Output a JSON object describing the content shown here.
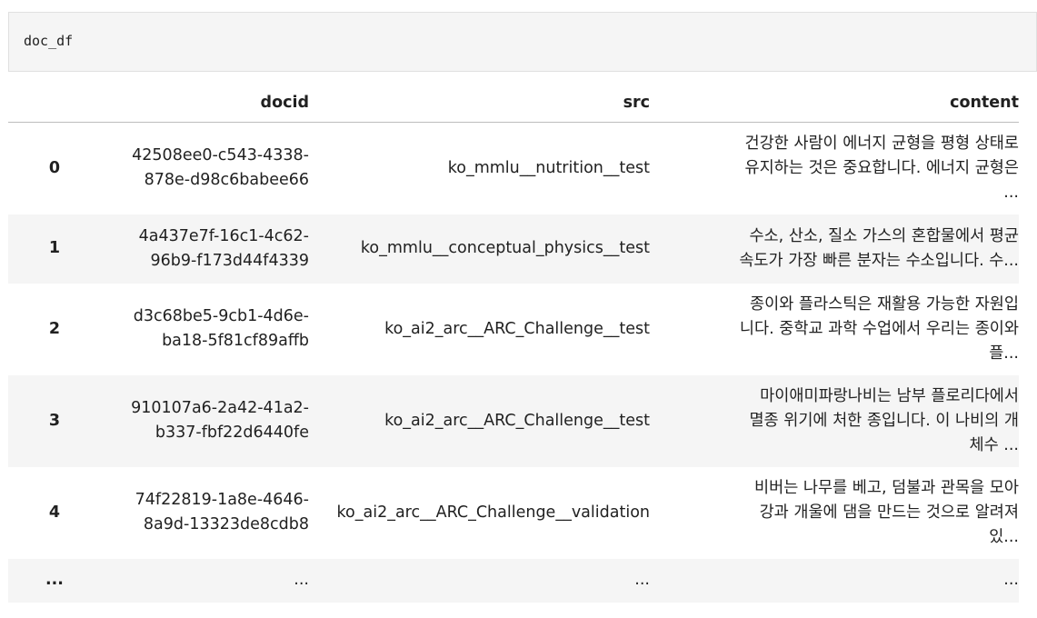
{
  "cell": {
    "code": "doc_df"
  },
  "table": {
    "columns": [
      "docid",
      "src",
      "content"
    ],
    "rows": [
      {
        "index": "0",
        "docid": [
          "42508ee0-c543-4338-",
          "878e-d98c6babee66"
        ],
        "src": "ko_mmlu__nutrition__test",
        "content": [
          "건강한 사람이 에너지 균형을 평형 상태로",
          "유지하는 것은 중요합니다. 에너지 균형은",
          "..."
        ]
      },
      {
        "index": "1",
        "docid": [
          "4a437e7f-16c1-4c62-",
          "96b9-f173d44f4339"
        ],
        "src": "ko_mmlu__conceptual_physics__test",
        "content": [
          "수소, 산소, 질소 가스의 혼합물에서 평균",
          "속도가 가장 빠른 분자는 수소입니다. 수..."
        ]
      },
      {
        "index": "2",
        "docid": [
          "d3c68be5-9cb1-4d6e-",
          "ba18-5f81cf89affb"
        ],
        "src": "ko_ai2_arc__ARC_Challenge__test",
        "content": [
          "종이와 플라스틱은 재활용 가능한 자원입",
          "니다. 중학교 과학 수업에서 우리는 종이와",
          "플..."
        ]
      },
      {
        "index": "3",
        "docid": [
          "910107a6-2a42-41a2-",
          "b337-fbf22d6440fe"
        ],
        "src": "ko_ai2_arc__ARC_Challenge__test",
        "content": [
          "마이애미파랑나비는 남부 플로리다에서",
          "멸종 위기에 처한 종입니다. 이 나비의 개",
          "체수 ..."
        ]
      },
      {
        "index": "4",
        "docid": [
          "74f22819-1a8e-4646-",
          "8a9d-13323de8cdb8"
        ],
        "src": "ko_ai2_arc__ARC_Challenge__validation",
        "content": [
          "비버는 나무를 베고, 덤불과 관목을 모아",
          "강과 개울에 댐을 만드는 것으로 알려져",
          "있..."
        ]
      }
    ],
    "ellipsis_row": {
      "index": "...",
      "docid": "...",
      "src": "...",
      "content": "..."
    }
  }
}
